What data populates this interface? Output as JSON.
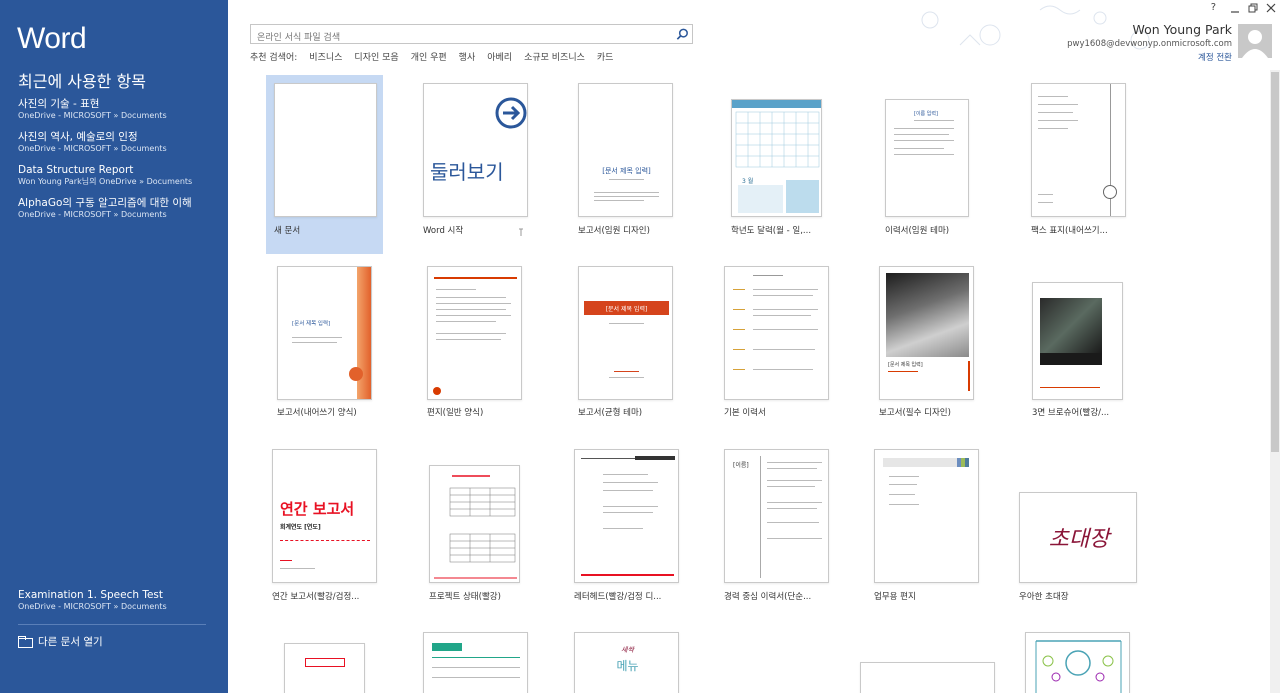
{
  "app": {
    "title": "Word"
  },
  "sidebar": {
    "recent_heading": "최근에 사용한 항목",
    "recent": [
      {
        "name": "사진의 기술 - 표현",
        "path": "OneDrive - MICROSOFT » Documents"
      },
      {
        "name": "사진의 역사, 예술로의 인정",
        "path": "OneDrive - MICROSOFT » Documents"
      },
      {
        "name": "Data Structure Report",
        "path": "Won Young Park님의 OneDrive » Documents"
      },
      {
        "name": "AlphaGo의 구동 알고리즘에 대한 이해",
        "path": "OneDrive - MICROSOFT » Documents"
      }
    ],
    "bottom_item": {
      "name": "Examination 1. Speech Test",
      "path": "OneDrive - MICROSOFT » Documents"
    },
    "open_other": "다른 문서 열기"
  },
  "search": {
    "placeholder": "온라인 서식 파일 검색",
    "suggested_label": "추천 검색어:",
    "suggested": [
      "비즈니스",
      "디자인 모음",
      "개인 우편",
      "행사",
      "아베리",
      "소규모 비즈니스",
      "카드"
    ]
  },
  "account": {
    "name": "Won Young Park",
    "email": "pwy1608@devwonyp.onmicrosoft.com",
    "switch": "계정 전환"
  },
  "window_controls": {
    "help": "?"
  },
  "templates": {
    "row1": [
      "새 문서",
      "Word 시작",
      "보고서(임원 디자인)",
      "학년도 달력(월 - 일,...",
      "이력서(임원 테마)",
      "팩스 표지(내어쓰기..."
    ],
    "row2": [
      "보고서(내어쓰기 양식)",
      "편지(일반 양식)",
      "보고서(균형 테마)",
      "기본 이력서",
      "보고서(필수 디자인)",
      "3면 브로슈어(빨강/..."
    ],
    "row3": [
      "연간 보고서(빨강/검정...",
      "프로젝트 상태(빨강)",
      "레터헤드(빨강/검정 디...",
      "경력 중심 이력서(단순...",
      "업무용 편지",
      "우아한 초대장"
    ]
  },
  "thumb_text": {
    "tour": "둘러보기",
    "report_title": "[문서 제목 입력]",
    "calendar_month": "3 월",
    "resume_name": "[이름 입력]",
    "annual_title": "연간 보고서",
    "annual_sub": "회계연도 [연도]",
    "invite": "초대장",
    "career_name": "[이름]",
    "menu_title": "메뉴",
    "menu_top": "새싹"
  },
  "colors": {
    "sidebar": "#2b579a",
    "accent_red": "#d83b01",
    "selected": "#c6d9f3"
  }
}
